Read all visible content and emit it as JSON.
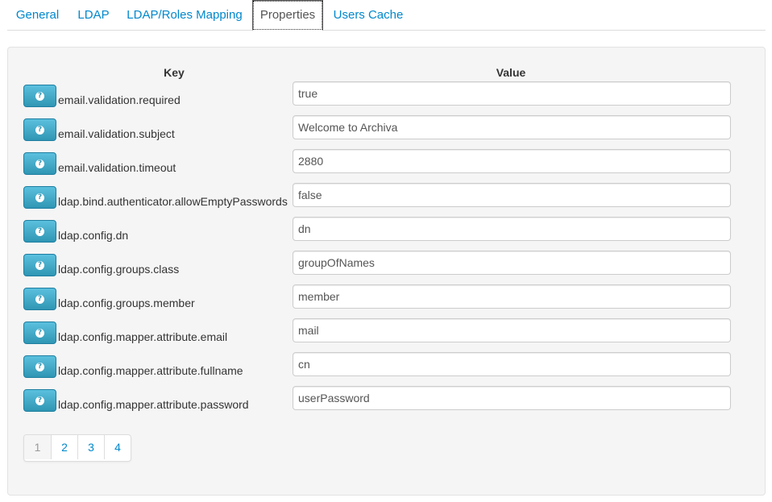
{
  "tabs": [
    {
      "label": "General"
    },
    {
      "label": "LDAP"
    },
    {
      "label": "LDAP/Roles Mapping"
    },
    {
      "label": "Properties"
    },
    {
      "label": "Users Cache"
    }
  ],
  "active_tab": "Properties",
  "table": {
    "key_header": "Key",
    "value_header": "Value",
    "help_button_icon": "question-circle-icon",
    "rows": [
      {
        "key": "email.validation.required",
        "value": "true"
      },
      {
        "key": "email.validation.subject",
        "value": "Welcome to Archiva"
      },
      {
        "key": "email.validation.timeout",
        "value": "2880"
      },
      {
        "key": "ldap.bind.authenticator.allowEmptyPasswords",
        "value": "false"
      },
      {
        "key": "ldap.config.dn",
        "value": "dn"
      },
      {
        "key": "ldap.config.groups.class",
        "value": "groupOfNames"
      },
      {
        "key": "ldap.config.groups.member",
        "value": "member"
      },
      {
        "key": "ldap.config.mapper.attribute.email",
        "value": "mail"
      },
      {
        "key": "ldap.config.mapper.attribute.fullname",
        "value": "cn"
      },
      {
        "key": "ldap.config.mapper.attribute.password",
        "value": "userPassword"
      }
    ]
  },
  "pagination": {
    "pages": [
      "1",
      "2",
      "3",
      "4"
    ],
    "current": "1"
  },
  "colors": {
    "link": "#0088cc",
    "help_button": "#49afcd",
    "panel_bg": "#f5f5f5"
  }
}
